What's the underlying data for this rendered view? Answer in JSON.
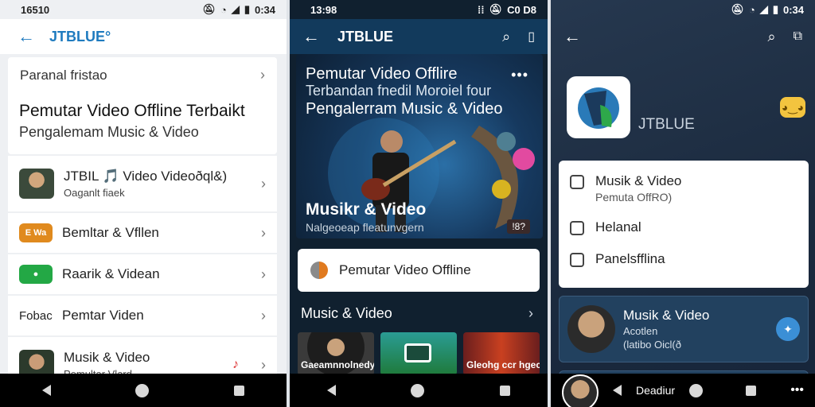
{
  "panel1": {
    "status_time": "16510",
    "status_right": "0:34",
    "app_title": "JTBLUE°",
    "subheader": "Paranal fristao",
    "title": "Pemutar Video Offline Terbaikt",
    "subtitle": "Pengalemam Music & Video",
    "items": [
      {
        "label": "JTBIL 🎵 Video Videoðql&)",
        "sub": "Oaganlt fiaek"
      },
      {
        "label": "Bemltar & Vfllen",
        "thumb_text": "E Wa"
      },
      {
        "label": "Raarik & Videan"
      },
      {
        "prefix": "Fobac",
        "label": "Pemtar Viden"
      },
      {
        "label": "Musik & Video",
        "sub": "Pemultar Vlard"
      }
    ]
  },
  "panel2": {
    "status_time": "13:98",
    "status_right": "C0 D8",
    "app_title": "JTBLUE",
    "hero_line1": "Pemutar Video Offlire",
    "hero_line2": "Terbandan fnedil Moroiel four",
    "hero_line3": "Pengalerram Music & Video",
    "hero_music": "Musikr & Video",
    "hero_sub": "Nalgeoeap fleatunvgern",
    "hero_badge": "!8?",
    "button_label": "Pemutar Video Offline",
    "section_title": "Music & Video",
    "tiles": [
      {
        "label": "Gaeamnnolnedy"
      },
      {
        "label": ""
      },
      {
        "label": "Gleohg ccr hgec"
      }
    ]
  },
  "panel3": {
    "status_right": "0:34",
    "brand": "JTBLUE",
    "menu": [
      {
        "label": "Musik & Video",
        "sub": "Pemuta OffRO)"
      },
      {
        "label": "Helanal"
      },
      {
        "label": "Panelsfflina"
      }
    ],
    "card_title": "Musik & Video",
    "card_sub1": "Acotlen",
    "card_sub2": "(latibo Oicl(ð",
    "nav_label": "Deadiur"
  },
  "colors": {
    "accent_blue": "#1f7bbf",
    "dark_bar": "#123a5c",
    "panel3_bg": "#1b2a3e"
  }
}
